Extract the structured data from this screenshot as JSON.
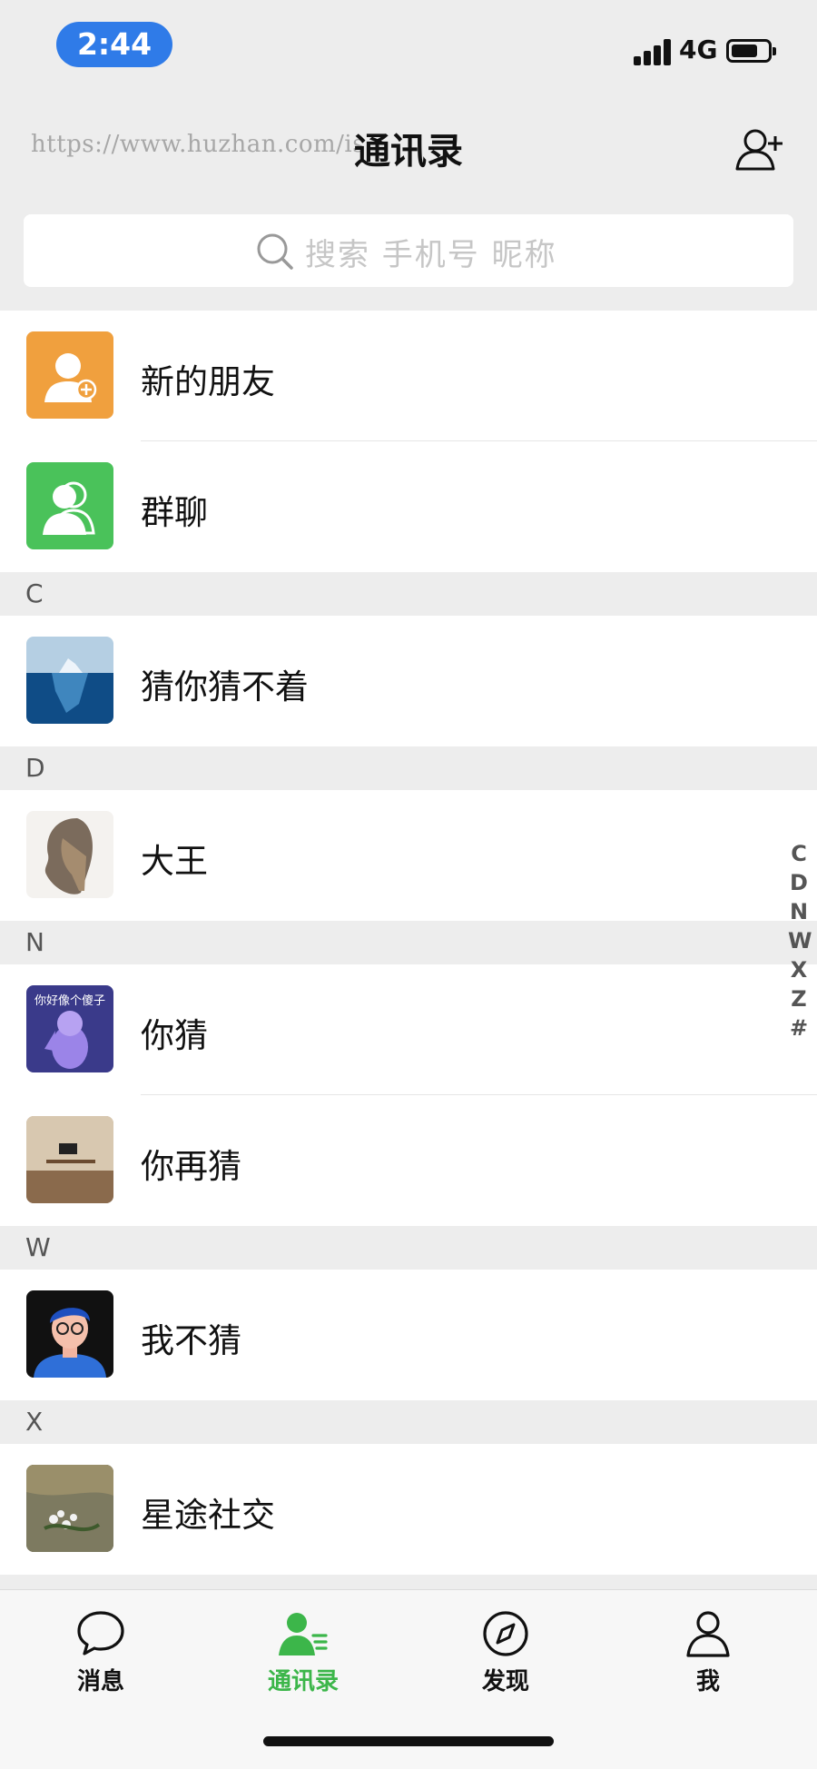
{
  "status_bar": {
    "time": "2:44",
    "network": "4G"
  },
  "header": {
    "title": "通讯录",
    "watermark": "https://www.huzhan.com/is"
  },
  "search": {
    "placeholder": "搜索 手机号 昵称"
  },
  "system_entries": [
    {
      "label": "新的朋友",
      "color": "#f0a03e"
    },
    {
      "label": "群聊",
      "color": "#4ac25a"
    }
  ],
  "sections": [
    {
      "letter": "C",
      "contacts": [
        "猜你猜不着"
      ]
    },
    {
      "letter": "D",
      "contacts": [
        "大王"
      ]
    },
    {
      "letter": "N",
      "contacts": [
        "你猜",
        "你再猜"
      ]
    },
    {
      "letter": "W",
      "contacts": [
        "我不猜"
      ]
    },
    {
      "letter": "X",
      "contacts": [
        "星途社交"
      ]
    }
  ],
  "avatar_caption": "你好像个傻子",
  "index": [
    "C",
    "D",
    "N",
    "W",
    "X",
    "Z",
    "#"
  ],
  "tabs": [
    {
      "label": "消息",
      "icon": "chat-bubble-icon",
      "active": false
    },
    {
      "label": "通讯录",
      "icon": "contacts-icon",
      "active": true
    },
    {
      "label": "发现",
      "icon": "compass-icon",
      "active": false
    },
    {
      "label": "我",
      "icon": "person-icon",
      "active": false
    }
  ],
  "colors": {
    "accent": "#3cb64a",
    "time_pill": "#2f7be8"
  }
}
